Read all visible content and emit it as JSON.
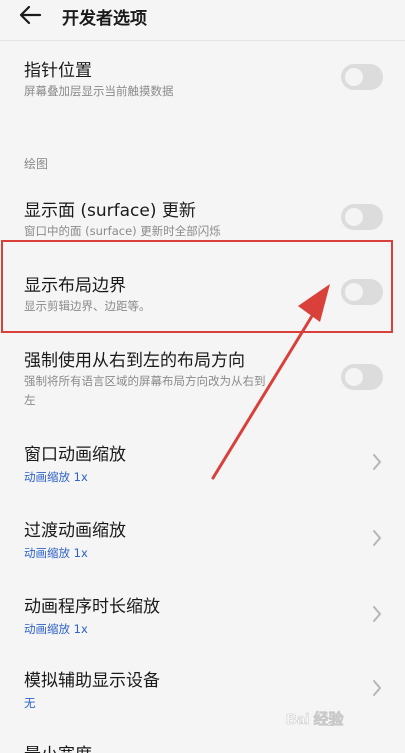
{
  "header": {
    "title": "开发者选项",
    "back_icon": "arrow-left-icon"
  },
  "rows": [
    {
      "title": "指针位置",
      "subtitle": "屏幕叠加层显示当前触摸数据",
      "control": "toggle",
      "on": false
    },
    {
      "section": "绘图"
    },
    {
      "title": "显示面 (surface) 更新",
      "subtitle": "窗口中的面 (surface) 更新时全部闪烁",
      "control": "toggle",
      "on": false
    },
    {
      "title": "显示布局边界",
      "subtitle": "显示剪辑边界、边距等。",
      "control": "toggle",
      "on": false,
      "highlighted": true
    },
    {
      "title": "强制使用从右到左的布局方向",
      "subtitle_line1": "强制将所有语言区域的屏幕布局方向改为从右到",
      "subtitle_line2": "左",
      "control": "toggle",
      "on": false
    },
    {
      "title": "窗口动画缩放",
      "value": "动画缩放 1x",
      "control": "chevron"
    },
    {
      "title": "过渡动画缩放",
      "value": "动画缩放 1x",
      "control": "chevron"
    },
    {
      "title": "动画程序时长缩放",
      "value": "动画缩放 1x",
      "control": "chevron"
    },
    {
      "title": "模拟辅助显示设备",
      "value": "无",
      "control": "chevron"
    },
    {
      "title": "最小宽度"
    }
  ],
  "annotation": {
    "color": "#d9403a",
    "shape": "red-rectangle-and-arrow"
  },
  "watermark": {
    "text": "Bai 经验",
    "icon": "baidu-paw-icon"
  }
}
